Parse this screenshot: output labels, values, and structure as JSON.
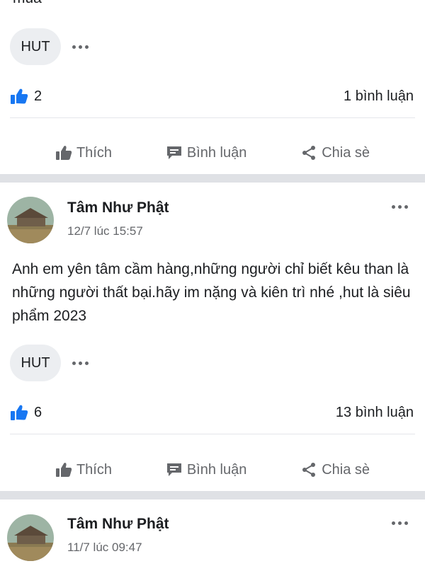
{
  "top_partial_text": "mua",
  "posts": [
    {
      "tag": "HUT",
      "likes": "2",
      "comments": "1 bình luận"
    },
    {
      "author": "Tâm Như Phật",
      "time": "12/7 lúc 15:57",
      "body": "Anh em yên tâm cầm hàng,những người chỉ biết kêu than là những người thất bại.hãy im nặng và kiên trì nhé ,hut là siêu phẩm 2023",
      "tag": "HUT",
      "likes": "6",
      "comments": "13 bình luận"
    },
    {
      "author": "Tâm Như Phật",
      "time": "11/7 lúc 09:47"
    }
  ],
  "actions": {
    "like": "Thích",
    "comment": "Bình luận",
    "share": "Chia sè"
  },
  "colors": {
    "like_blue": "#1877f2",
    "icon_gray": "#65676b",
    "separator": "#dfe1e5"
  },
  "icons": [
    "thumbs-up-icon",
    "comment-icon",
    "share-icon",
    "more-icon",
    "like-badge-icon"
  ]
}
